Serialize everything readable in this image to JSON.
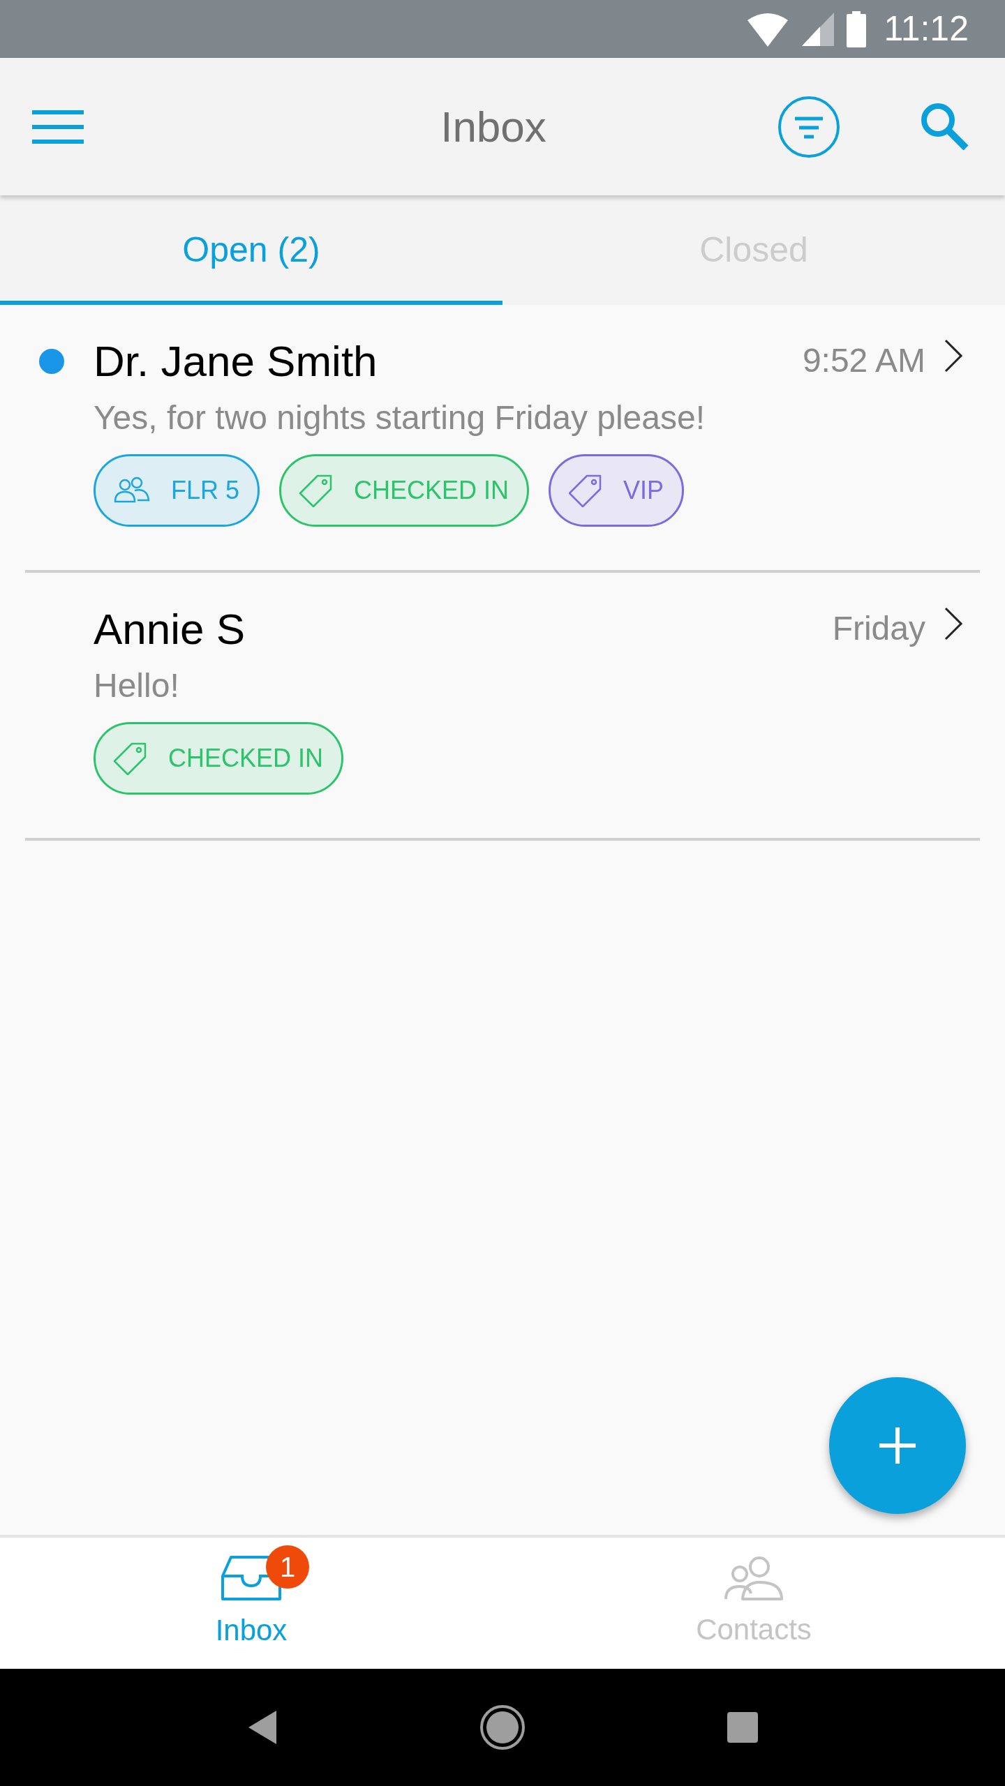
{
  "status_bar": {
    "time": "11:12"
  },
  "app_bar": {
    "title": "Inbox"
  },
  "tabs": [
    {
      "label": "Open (2)",
      "selected": true
    },
    {
      "label": "Closed",
      "selected": false
    }
  ],
  "conversations": [
    {
      "name": "Dr. Jane Smith",
      "unread": true,
      "time": "9:52 AM",
      "preview": "Yes, for two nights starting Friday please!",
      "tags": [
        {
          "kind": "group",
          "label": "FLR 5",
          "color": "#1ba6e0"
        },
        {
          "kind": "tag",
          "label": "CHECKED IN",
          "color": "#2cc46a"
        },
        {
          "kind": "tag",
          "label": "VIP",
          "color": "#7b6ae0"
        }
      ]
    },
    {
      "name": "Annie S",
      "unread": false,
      "time": "Friday",
      "preview": "Hello!",
      "tags": [
        {
          "kind": "tag",
          "label": "CHECKED IN",
          "color": "#2cc46a"
        }
      ]
    }
  ],
  "bottom_nav": [
    {
      "kind": "inbox",
      "label": "Inbox",
      "selected": true,
      "badge": "1"
    },
    {
      "kind": "contacts",
      "label": "Contacts",
      "selected": false
    }
  ]
}
